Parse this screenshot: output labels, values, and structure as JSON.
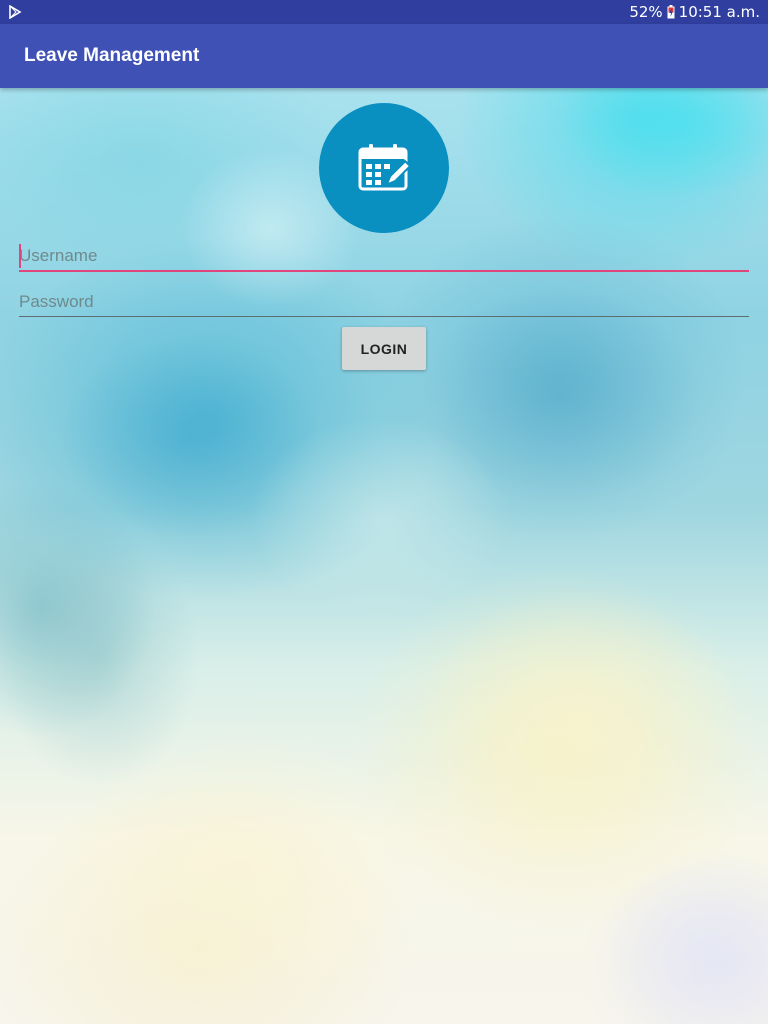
{
  "status_bar": {
    "battery_percent": "52%",
    "time": "10:51 a.m.",
    "left_icon": "play-store-notification-icon",
    "battery_icon": "battery-icon",
    "background_color": "#303f9f"
  },
  "app_bar": {
    "title": "Leave Management",
    "background_color": "#3f51b5"
  },
  "logo": {
    "icon": "calendar-edit-icon",
    "background_color": "#0a8fc1"
  },
  "form": {
    "username": {
      "placeholder": "Username",
      "value": "",
      "focused": true,
      "accent_color": "#e0457b"
    },
    "password": {
      "placeholder": "Password",
      "value": ""
    },
    "login_button": {
      "label": "LOGIN"
    }
  }
}
